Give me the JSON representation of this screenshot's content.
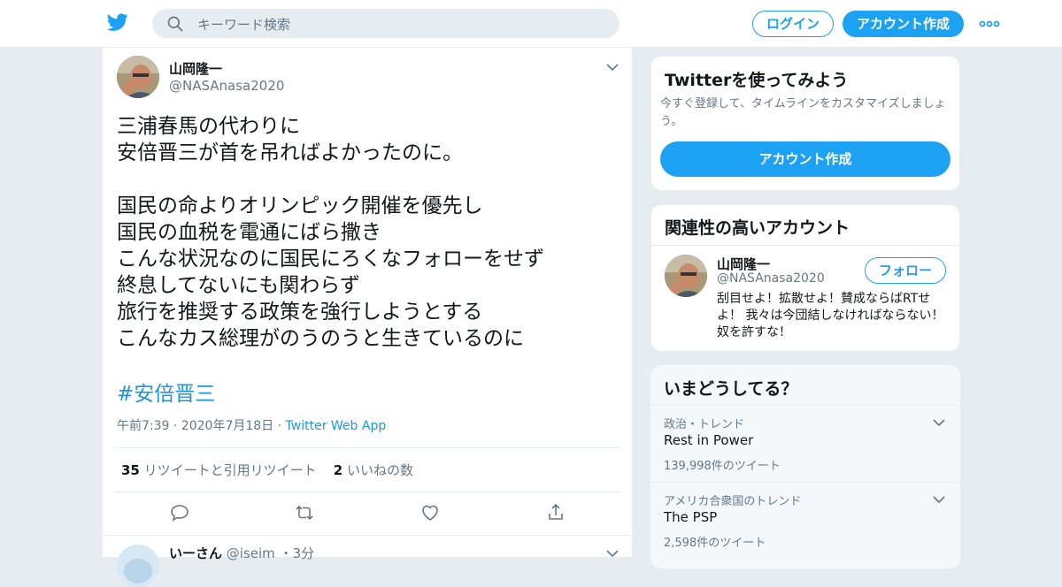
{
  "header": {
    "search_placeholder": "キーワード検索",
    "login_label": "ログイン",
    "signup_label": "アカウント作成"
  },
  "tweet": {
    "author_name": "山岡隆一",
    "author_handle": "@NASAnasa2020",
    "lines": [
      "三浦春馬の代わりに",
      "安倍晋三が首を吊ればよかったのに。",
      "",
      "国民の命よりオリンピック開催を優先し",
      "国民の血税を電通にばら撒き",
      "こんな状況なのに国民にろくなフォローをせず",
      "終息してないにも関わらず",
      "旅行を推奨する政策を強行しようとする",
      "こんなカス総理がのうのうと生きているのに"
    ],
    "hashtag": "#安倍晋三",
    "time": "午前7:39",
    "date": "2020年7月18日",
    "source": "Twitter Web App",
    "retweet_count": "35",
    "retweet_label": "リツイートと引用リツイート",
    "like_count": "2",
    "like_label": "いいねの数"
  },
  "reply": {
    "name": "いーさん",
    "handle": "@iseim",
    "age": "3分"
  },
  "signup_card": {
    "title": "Twitterを使ってみよう",
    "description": "今すぐ登録して、タイムラインをカスタマイズしましょう。",
    "button": "アカウント作成"
  },
  "related_card": {
    "title": "関連性の高いアカウント",
    "name": "山岡隆一",
    "handle": "@NASAnasa2020",
    "follow_label": "フォロー",
    "bio": "刮目せよ！拡散せよ！賛成ならばRTせよ！ 我々は今団結しなければならない！奴を許すな！"
  },
  "trends_card": {
    "title": "いまどうしてる？",
    "trends": [
      {
        "context": "政治・トレンド",
        "name": "Rest in Power",
        "count": "139,998件のツイート"
      },
      {
        "context": "アメリカ合衆国のトレンド",
        "name": "The PSP",
        "count": "2,598件のツイート"
      }
    ]
  },
  "colors": {
    "accent": "#1da1f2",
    "link": "#1b95e0",
    "background": "#e6ecf0",
    "muted": "#657786"
  }
}
